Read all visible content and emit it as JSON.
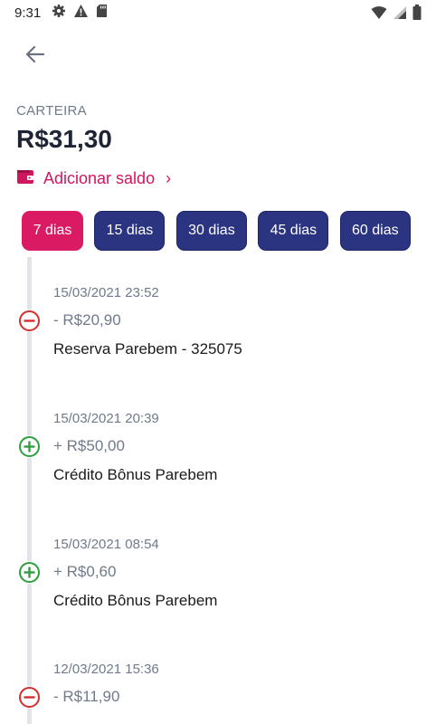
{
  "status_bar": {
    "time": "9:31",
    "icons_left": [
      "gear-icon",
      "warning-icon",
      "sd-card-icon"
    ],
    "icons_right": [
      "wifi-icon",
      "signal-icon",
      "battery-icon"
    ]
  },
  "header": {
    "back_icon": "arrow-left-icon"
  },
  "wallet": {
    "label": "CARTEIRA",
    "balance": "R$31,30",
    "add_balance_label": "Adicionar saldo",
    "add_balance_icon": "wallet-icon",
    "accent_color": "#d0165f"
  },
  "filters": [
    {
      "label": "7 dias",
      "active": true
    },
    {
      "label": "15 dias",
      "active": false
    },
    {
      "label": "30 dias",
      "active": false
    },
    {
      "label": "45 dias",
      "active": false
    },
    {
      "label": "60 dias",
      "active": false
    }
  ],
  "transactions": [
    {
      "date": "15/03/2021 23:52",
      "amount": "- R$20,90",
      "description": "Reserva Parebem - 325075",
      "type": "debit"
    },
    {
      "date": "15/03/2021 20:39",
      "amount": "+ R$50,00",
      "description": "Crédito Bônus Parebem",
      "type": "credit"
    },
    {
      "date": "15/03/2021 08:54",
      "amount": "+ R$0,60",
      "description": "Crédito Bônus Parebem",
      "type": "credit"
    },
    {
      "date": "12/03/2021 15:36",
      "amount": "- R$11,90",
      "description": "",
      "type": "debit"
    }
  ],
  "colors": {
    "debit": "#d32f2f",
    "credit": "#2e9e3e",
    "chip_active": "#db1a64",
    "chip_inactive": "#2b3480"
  }
}
